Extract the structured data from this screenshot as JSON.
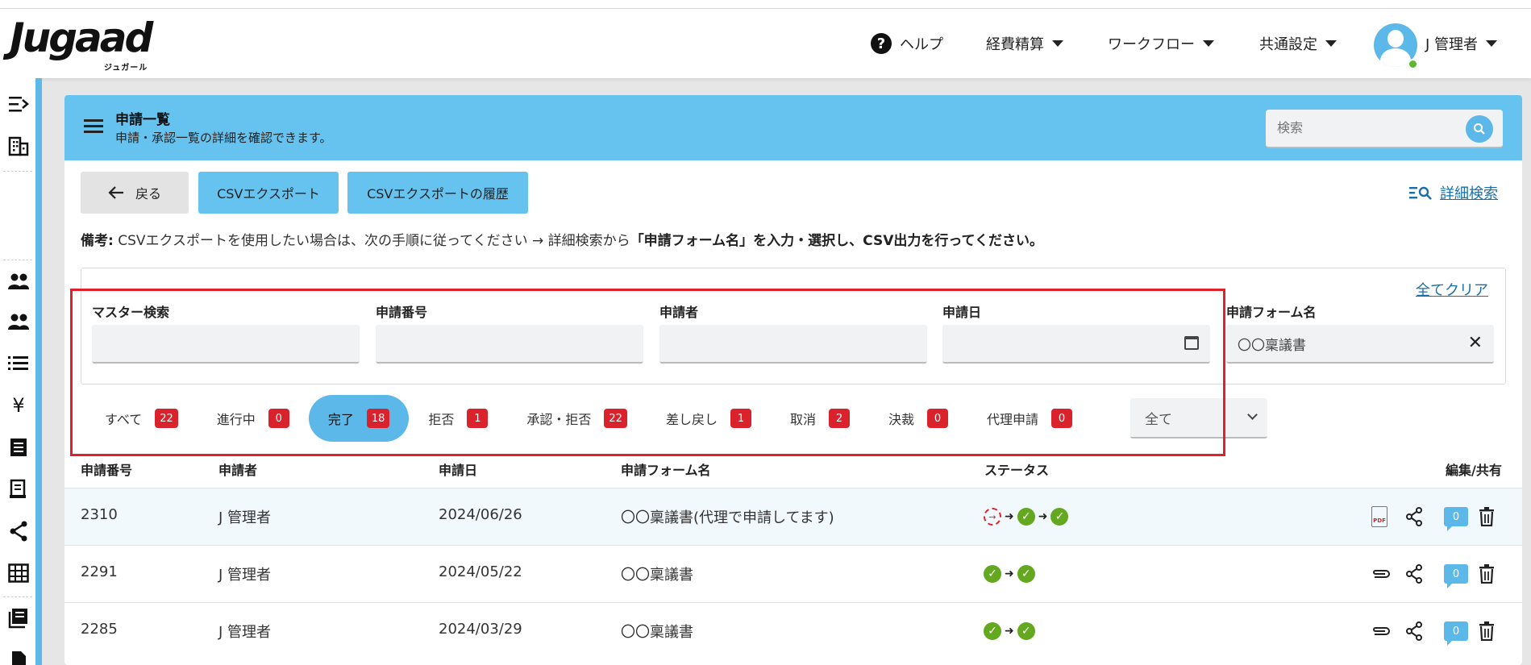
{
  "brand": {
    "logo_text": "Jugaad",
    "logo_kana": "ジュガール"
  },
  "nav": {
    "help": "ヘルプ",
    "expense": "経費精算",
    "workflow": "ワークフロー",
    "common_settings": "共通設定",
    "user_name": "J 管理者"
  },
  "sidebar": {
    "icons": [
      "menu-expand-icon",
      "building-icon",
      "users-icon",
      "user-group-icon",
      "list-icon",
      "yen-icon",
      "receipt-icon",
      "document-icon",
      "share-icon",
      "grid-icon",
      "book-icon",
      "file-icon"
    ]
  },
  "page": {
    "title": "申請一覧",
    "subtitle": "申請・承認一覧の詳細を確認できます。",
    "search_placeholder": "検索",
    "back_label": "戻る",
    "csv_export": "CSVエクスポート",
    "csv_history": "CSVエクスポートの履歴",
    "advanced_search": "詳細検索",
    "note_label": "備考:",
    "note_text": " CSVエクスポートを使用したい場合は、次の手順に従ってください → 詳細検索から",
    "note_bold": "「申請フォーム名」を入力・選択し、CSV出力を行ってください。",
    "clear_all": "全てクリア"
  },
  "filters": {
    "master_search": {
      "label": "マスター検索",
      "value": ""
    },
    "request_no": {
      "label": "申請番号",
      "value": ""
    },
    "applicant": {
      "label": "申請者",
      "value": ""
    },
    "request_date": {
      "label": "申請日",
      "value": ""
    },
    "form_name": {
      "label": "申請フォーム名",
      "value": "〇〇稟議書"
    }
  },
  "status_tabs": [
    {
      "label": "すべて",
      "count": "22"
    },
    {
      "label": "進行中",
      "count": "0"
    },
    {
      "label": "完了",
      "count": "18",
      "active": true
    },
    {
      "label": "拒否",
      "count": "1"
    },
    {
      "label": "承認・拒否",
      "count": "22"
    },
    {
      "label": "差し戻し",
      "count": "1"
    },
    {
      "label": "取消",
      "count": "2"
    },
    {
      "label": "決裁",
      "count": "0"
    },
    {
      "label": "代理申請",
      "count": "0"
    }
  ],
  "dropdown": {
    "selected": "全て"
  },
  "table": {
    "headers": {
      "no": "申請番号",
      "applicant": "申請者",
      "date": "申請日",
      "form": "申請フォーム名",
      "status": "ステータス",
      "edit": "編集/共有"
    },
    "rows": [
      {
        "no": "2310",
        "applicant": "J 管理者",
        "date": "2024/06/26",
        "form": "〇〇稟議書(代理で申請してます)",
        "comments": "0"
      },
      {
        "no": "2291",
        "applicant": "J 管理者",
        "date": "2024/05/22",
        "form": "〇〇稟議書",
        "comments": "0"
      },
      {
        "no": "2285",
        "applicant": "J 管理者",
        "date": "2024/03/29",
        "form": "〇〇稟議書",
        "comments": "0"
      }
    ]
  },
  "colors": {
    "accent": "#66c3ef",
    "badge": "#d9222b",
    "check": "#64a81f",
    "highlight": "#e0202a"
  }
}
